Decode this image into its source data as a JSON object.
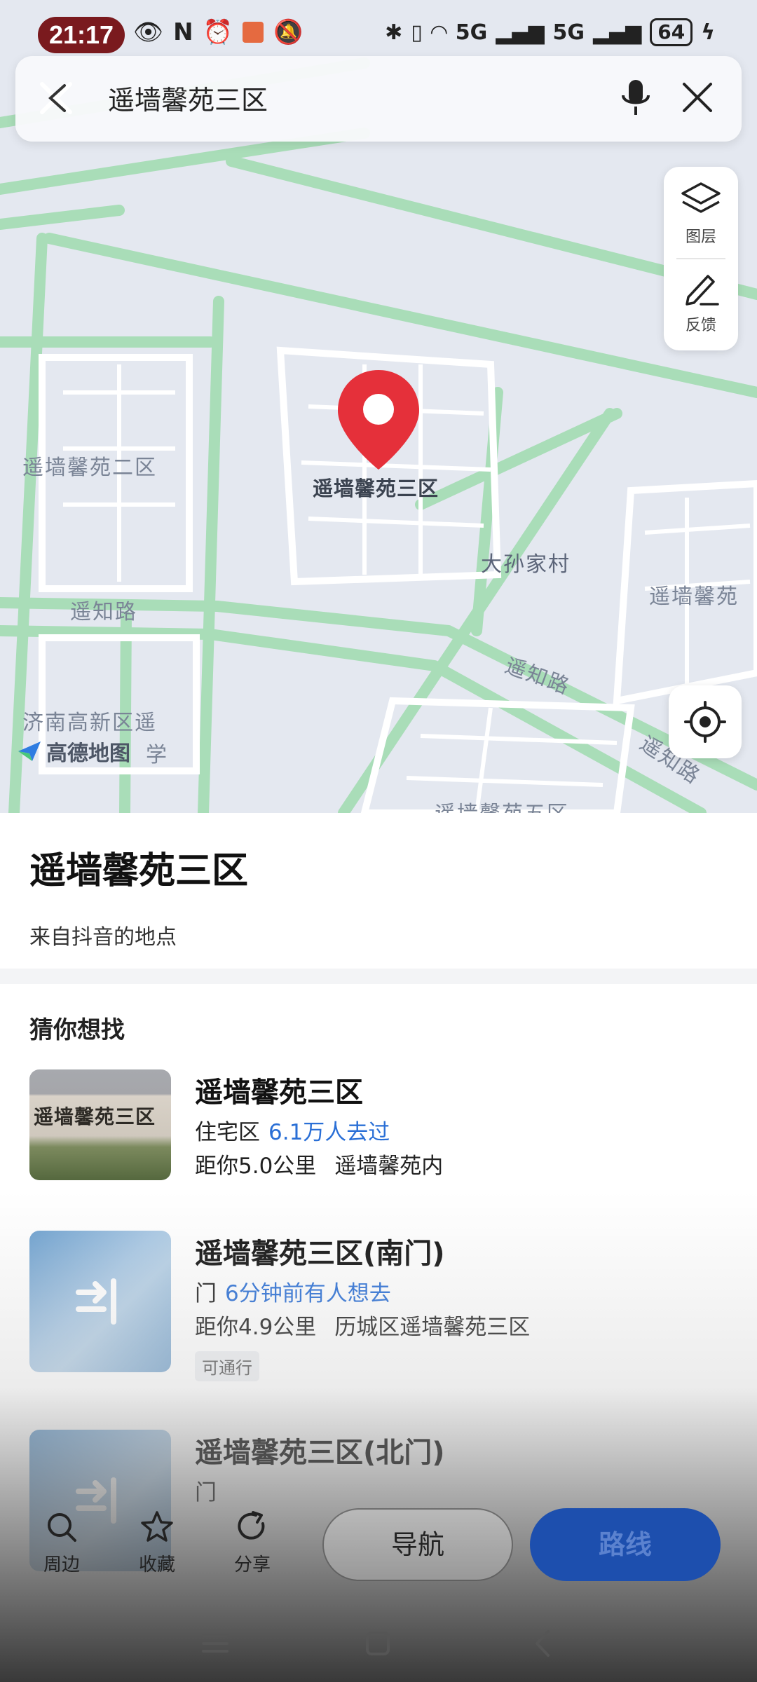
{
  "status_bar": {
    "time": "21:17",
    "battery": "64",
    "signal_1": "5G",
    "signal_2": "5G"
  },
  "search": {
    "query": "遥墙馨苑三区"
  },
  "map_tools": {
    "layers_label": "图层",
    "feedback_label": "反馈"
  },
  "map": {
    "pin_label": "遥墙馨苑三区",
    "labels": [
      "遥墙馨苑二区",
      "大孙家村",
      "遥墙馨苑",
      "遥知路",
      "遥知路",
      "遥知路",
      "济南高新区遥",
      "学",
      "遥墙馨苑五区"
    ],
    "logo_text": "高德地图"
  },
  "place": {
    "title": "遥墙馨苑三区",
    "source": "来自抖音的地点"
  },
  "suggestions": {
    "title": "猜你想找",
    "items": [
      {
        "name": "遥墙馨苑三区",
        "category": "住宅区",
        "hot": "6.1万人去过",
        "distance": "距你5.0公里",
        "address": "遥墙馨苑内",
        "thumb_text": "遥墙馨苑三区"
      },
      {
        "name": "遥墙馨苑三区(南门)",
        "category": "门",
        "hot": "6分钟前有人想去",
        "distance": "距你4.9公里",
        "address": "历城区遥墙馨苑三区",
        "tag": "可通行"
      },
      {
        "name": "遥墙馨苑三区(北门)",
        "category": "门"
      }
    ]
  },
  "bottom_bar": {
    "nearby": "周边",
    "favorite": "收藏",
    "share": "分享",
    "navigate": "导航",
    "route": "路线"
  },
  "colors": {
    "accent_blue": "#2a6fd6",
    "route_button": "#1d4fae",
    "pin_red": "#e5303a",
    "road_green": "#a8dcb6"
  }
}
